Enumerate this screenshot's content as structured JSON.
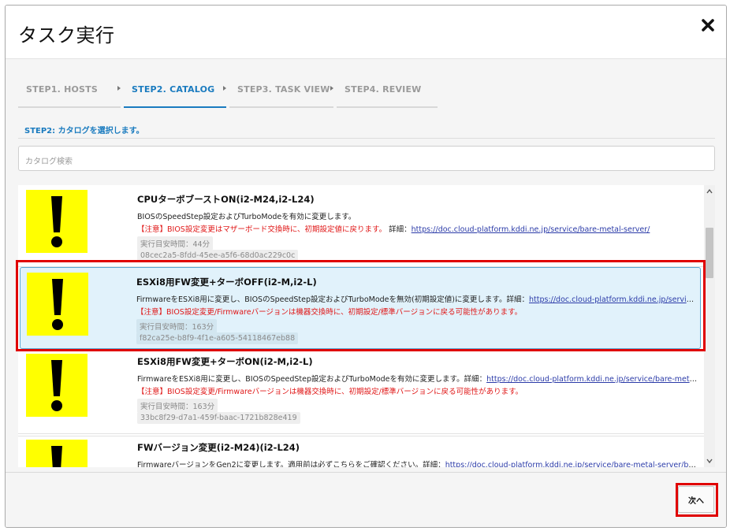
{
  "dialog": {
    "title": "タスク実行",
    "close_icon": "close-icon"
  },
  "steps": [
    {
      "label": "STEP1. HOSTS",
      "active": false
    },
    {
      "label": "STEP2. CATALOG",
      "active": true
    },
    {
      "label": "STEP3. TASK VIEW",
      "active": false
    },
    {
      "label": "STEP4. REVIEW",
      "active": false
    }
  ],
  "step_description": "STEP2: カタログを選択します。",
  "search": {
    "placeholder": "カタログ検索",
    "value": ""
  },
  "catalog_items": [
    {
      "title": "CPUターボブーストON(i2-M24,i2-L24)",
      "description": "BIOSのSpeedStep設定およびTurboModeを有効に変更します。",
      "warning": "【注意】BIOS設定変更はマザーボード交換時に、初期設定値に戻ります。",
      "detail_label": "詳細：",
      "detail_link": "https://doc.cloud-platform.kddi.ne.jp/service/bare-metal-server/",
      "time": "実行目安時間：44分",
      "uuid": "08cec2a5-8fdd-45ee-a5f6-68d0ac229c0c",
      "selected": false
    },
    {
      "title": "ESXi8用FW変更+ターボOFF(i2-M,i2-L)",
      "description": "FirmwareをESXi8用に変更し、BIOSのSpeedStep設定およびTurboModeを無効(初期設定値)に変更します。",
      "detail_label": "詳細：",
      "detail_link": "https://doc.cloud-platform.kddi.ne.jp/service/ba…",
      "warning": "【注意】BIOS設定変更/Firmwareバージョンは機器交換時に、初期設定/標準バージョンに戻る可能性があります。",
      "time": "実行目安時間：163分",
      "uuid": "f82ca25e-b8f9-4f1e-a605-54118467eb88",
      "selected": true
    },
    {
      "title": "ESXi8用FW変更+ターボON(i2-M,i2-L)",
      "description": "FirmwareをESXi8用に変更し、BIOSのSpeedStep設定およびTurboModeを有効に変更します。",
      "detail_label": "詳細：",
      "detail_link": "https://doc.cloud-platform.kddi.ne.jp/service/bare-metal-ser…",
      "warning": "【注意】BIOS設定変更/Firmwareバージョンは機器交換時に、初期設定/標準バージョンに戻る可能性があります。",
      "time": "実行目安時間：163分",
      "uuid": "33bc8f29-d7a1-459f-baac-1721b828e419",
      "selected": false
    },
    {
      "title": "FWバージョン変更(i2-M24)(i2-L24)",
      "description": "FirmwareバージョンをGen2に変更します。適用前は必ずこちらをご確認ください。",
      "detail_label": "詳細：",
      "detail_link": "https://doc.cloud-platform.kddi.ne.jp/service/bare-metal-server/bare…",
      "selected": false
    }
  ],
  "footer": {
    "next_label": "次へ"
  },
  "colors": {
    "accent": "#1a7bbf",
    "warning_text": "#e01818",
    "link": "#2b3ba8",
    "selected_bg": "#e1f2fb",
    "highlight_outline": "#e00000",
    "icon_bg": "#ffff00"
  }
}
